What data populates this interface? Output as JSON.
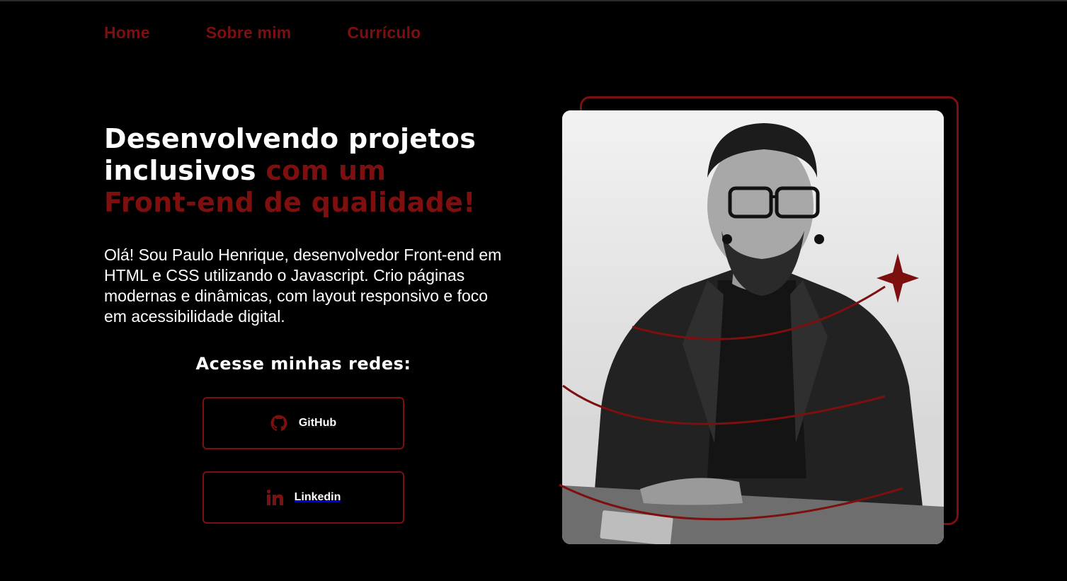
{
  "nav": {
    "items": [
      {
        "label": "Home"
      },
      {
        "label": "Sobre mim"
      },
      {
        "label": "Currículo"
      }
    ]
  },
  "hero": {
    "title_white_line1": "Desenvolvendo projetos",
    "title_white_line2": "inclusivos ",
    "title_accent_line2": "com um",
    "title_accent_line3": "Front-end de qualidade!",
    "bio": "Olá! Sou Paulo Henrique, desenvolvedor Front-end em HTML e CSS utilizando o Javascript. Crio páginas modernas e dinâmicas, com layout responsivo e foco em acessibilidade digital."
  },
  "social": {
    "title": "Acesse minhas redes:",
    "github": {
      "label": "GitHub",
      "icon": "github-icon"
    },
    "linkedin": {
      "label": "Linkedin",
      "icon": "linkedin-icon"
    }
  },
  "colors": {
    "background": "#000000",
    "accent": "#7d0f0f",
    "text": "#ffffff"
  }
}
